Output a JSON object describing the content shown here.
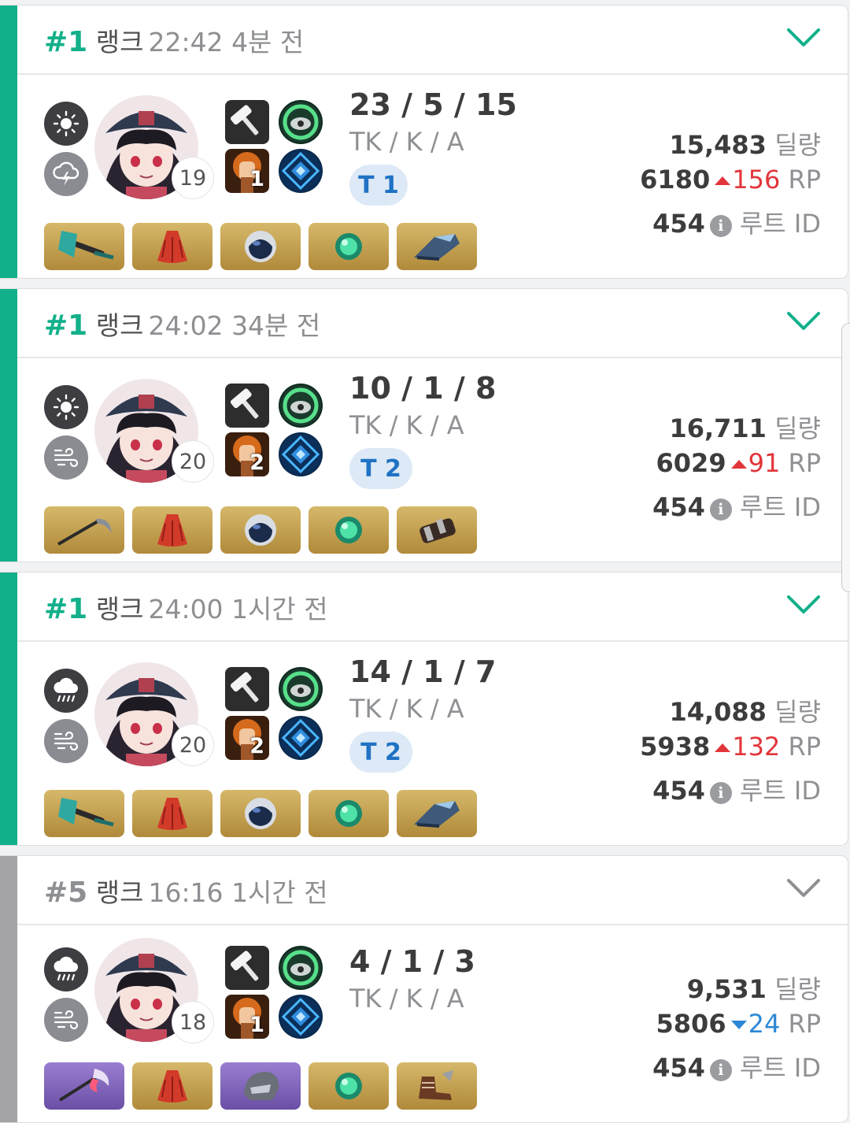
{
  "colors": {
    "win": "#12b08a",
    "lose": "#a4a4a6",
    "rp_up": "#e2353a",
    "rp_down": "#2c88d6"
  },
  "labels": {
    "rank_word": "랭크",
    "kda_label": "TK / K / A",
    "damage_unit": "딜량",
    "rp_unit": "RP",
    "root_unit": "루트 ID"
  },
  "matches": [
    {
      "result": "win",
      "rank": "#1",
      "time": "22:42",
      "ago": "4분 전",
      "level": "19",
      "kda": "23 / 5 / 15",
      "team": "T 1",
      "damage": "15,483",
      "rp": "6180",
      "rp_delta": "156",
      "rp_dir": "up",
      "root_id": "454",
      "weather": [
        "sun-icon",
        "thunder-cloud-icon"
      ],
      "trait_level": "1",
      "items": [
        "axe-icon",
        "red-cloak-icon",
        "helmet-icon",
        "green-orb-icon",
        "blue-boots-icon"
      ]
    },
    {
      "result": "win",
      "rank": "#1",
      "time": "24:02",
      "ago": "34분 전",
      "level": "20",
      "kda": "10 / 1 / 8",
      "team": "T 2",
      "damage": "16,711",
      "rp": "6029",
      "rp_delta": "91",
      "rp_dir": "up",
      "root_id": "454",
      "weather": [
        "sun-icon",
        "wind-icon"
      ],
      "trait_level": "2",
      "items": [
        "scythe-icon",
        "red-cloak-icon",
        "helmet-icon",
        "green-orb-icon",
        "dark-boots-icon"
      ]
    },
    {
      "result": "win",
      "rank": "#1",
      "time": "24:00",
      "ago": "1시간 전",
      "level": "20",
      "kda": "14 / 1 / 7",
      "team": "T 2",
      "damage": "14,088",
      "rp": "5938",
      "rp_delta": "132",
      "rp_dir": "up",
      "root_id": "454",
      "weather": [
        "rain-cloud-icon",
        "wind-icon"
      ],
      "trait_level": "2",
      "items": [
        "axe-icon",
        "red-cloak-icon",
        "helmet-icon",
        "green-orb-icon",
        "blue-boots-icon"
      ]
    },
    {
      "result": "lose",
      "rank": "#5",
      "time": "16:16",
      "ago": "1시간 전",
      "level": "18",
      "kda": "4 / 1 / 3",
      "team": "",
      "damage": "9,531",
      "rp": "5806",
      "rp_delta": "24",
      "rp_dir": "down",
      "root_id": "454",
      "weather": [
        "rain-cloud-icon",
        "wind-icon"
      ],
      "trait_level": "1",
      "items": [
        "purple-axe-icon",
        "red-cloak-icon",
        "purple-helmet-icon",
        "green-orb-icon",
        "brown-boots-icon"
      ]
    }
  ]
}
